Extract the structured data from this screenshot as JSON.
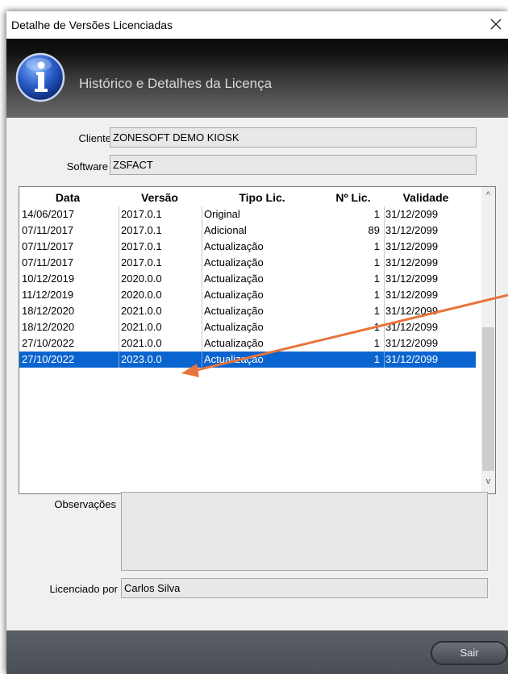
{
  "window": {
    "title": "Detalhe de Versões Licenciadas",
    "close_symbol": "✕"
  },
  "header": {
    "title": "Histórico e Detalhes da Licença",
    "icon": "info-icon"
  },
  "form": {
    "cliente_label": "Cliente",
    "cliente_value": "ZONESOFT DEMO KIOSK",
    "software_label": "Software",
    "software_value": "ZSFACT",
    "observacoes_label": "Observações",
    "observacoes_value": "",
    "licenciado_label": "Licenciado por",
    "licenciado_value": "Carlos Silva"
  },
  "table": {
    "columns": [
      "Data",
      "Versão",
      "Tipo Lic.",
      "Nº Lic.",
      "Validade"
    ],
    "rows": [
      {
        "data": "14/06/2017",
        "versao": "2017.0.1",
        "tipo": "Original",
        "num": "1",
        "validade": "31/12/2099"
      },
      {
        "data": "07/11/2017",
        "versao": "2017.0.1",
        "tipo": "Adicional",
        "num": "89",
        "validade": "31/12/2099"
      },
      {
        "data": "07/11/2017",
        "versao": "2017.0.1",
        "tipo": "Actualização",
        "num": "1",
        "validade": "31/12/2099"
      },
      {
        "data": "07/11/2017",
        "versao": "2017.0.1",
        "tipo": "Actualização",
        "num": "1",
        "validade": "31/12/2099"
      },
      {
        "data": "10/12/2019",
        "versao": "2020.0.0",
        "tipo": "Actualização",
        "num": "1",
        "validade": "31/12/2099"
      },
      {
        "data": "11/12/2019",
        "versao": "2020.0.0",
        "tipo": "Actualização",
        "num": "1",
        "validade": "31/12/2099"
      },
      {
        "data": "18/12/2020",
        "versao": "2021.0.0",
        "tipo": "Actualização",
        "num": "1",
        "validade": "31/12/2099"
      },
      {
        "data": "18/12/2020",
        "versao": "2021.0.0",
        "tipo": "Actualização",
        "num": "1",
        "validade": "31/12/2099"
      },
      {
        "data": "27/10/2022",
        "versao": "2021.0.0",
        "tipo": "Actualização",
        "num": "1",
        "validade": "31/12/2099"
      },
      {
        "data": "27/10/2022",
        "versao": "2023.0.0",
        "tipo": "Actualização",
        "num": "1",
        "validade": "31/12/2099"
      }
    ],
    "selected_index": 9,
    "scroll_up": "^",
    "scroll_down": "v"
  },
  "footer": {
    "sair_label": "Sair"
  },
  "colors": {
    "selection": "#0a64cf",
    "annotation_arrow": "#e8743b"
  }
}
